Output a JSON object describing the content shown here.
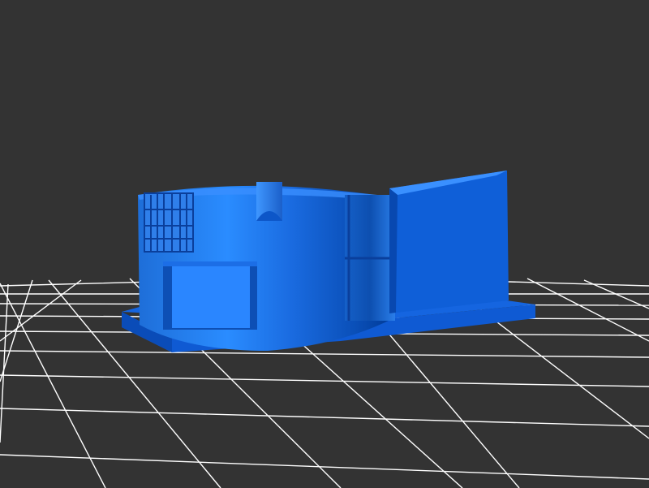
{
  "viewer": {
    "background_color": "#333333",
    "grid_color": "#ffffff",
    "model_color": "#1565e0",
    "model_highlight_color": "#2b8cff",
    "model_shadow_color": "#003c9a",
    "grid_visible": true
  },
  "model": {
    "description_icon": "3d-model-icon"
  }
}
